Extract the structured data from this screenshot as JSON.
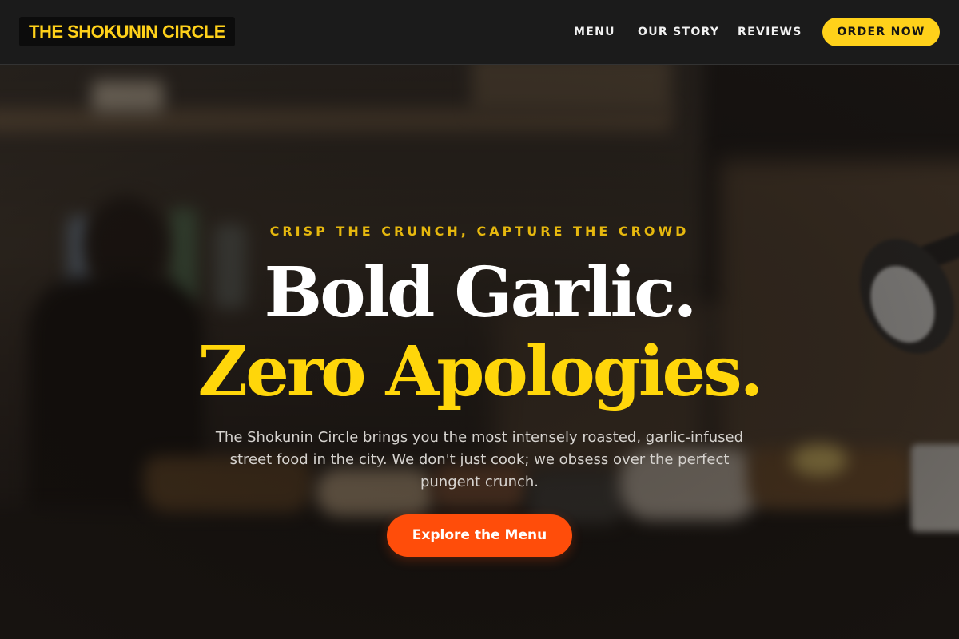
{
  "brand": {
    "name": "THE SHOKUNIN CIRCLE",
    "accent_color": "#ffd11a",
    "cta_color": "#ff4d0a"
  },
  "nav": {
    "links": [
      {
        "label": "MENU"
      },
      {
        "label": "OUR STORY"
      },
      {
        "label": "REVIEWS"
      }
    ],
    "order_label": "ORDER NOW"
  },
  "hero": {
    "eyebrow": "CRISP THE CRUNCH, CAPTURE THE CROWD",
    "headline_line1": "Bold Garlic.",
    "headline_line2": "Zero Apologies.",
    "description": "The Shokunin Circle brings you the most intensely roasted, garlic-infused street food in the city. We don't just cook; we obsess over the perfect pungent crunch.",
    "cta_label": "Explore the Menu"
  }
}
